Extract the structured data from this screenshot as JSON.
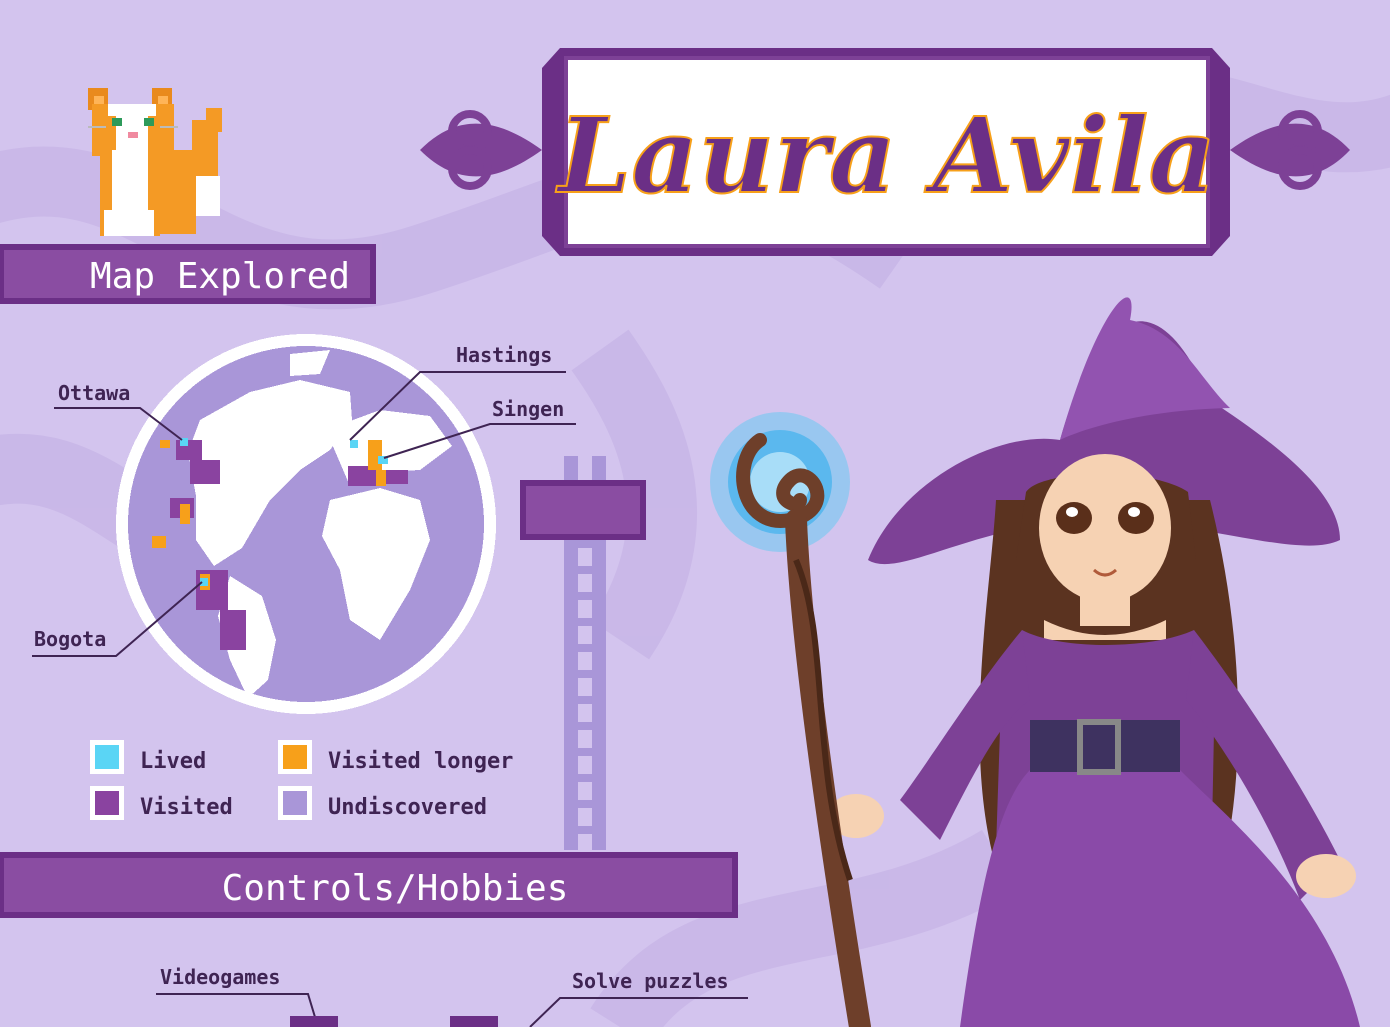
{
  "name_banner": {
    "text": "Laura Avila"
  },
  "sections": {
    "map": "Map Explored",
    "hobbies": "Controls/Hobbies"
  },
  "map_labels": {
    "hastings": "Hastings",
    "ottawa": "Ottawa",
    "singen": "Singen",
    "bogota": "Bogota"
  },
  "legend": [
    {
      "label": "Lived",
      "color": "#5ad5f5"
    },
    {
      "label": "Visited longer",
      "color": "#f7a01a"
    },
    {
      "label": "Visited",
      "color": "#8a43a0"
    },
    {
      "label": "Undiscovered",
      "color": "#a996d8"
    }
  ],
  "hobbies": {
    "videogames": "Videogames",
    "puzzles": "Solve puzzles"
  },
  "colors": {
    "background": "#d3c4ee",
    "accent_purple": "#7d4196",
    "orange": "#f7a01a",
    "cyan": "#5ad5f5"
  },
  "icons": [
    "cat-sprite-icon",
    "globe-map",
    "ladder",
    "witch-character",
    "magic-staff"
  ]
}
